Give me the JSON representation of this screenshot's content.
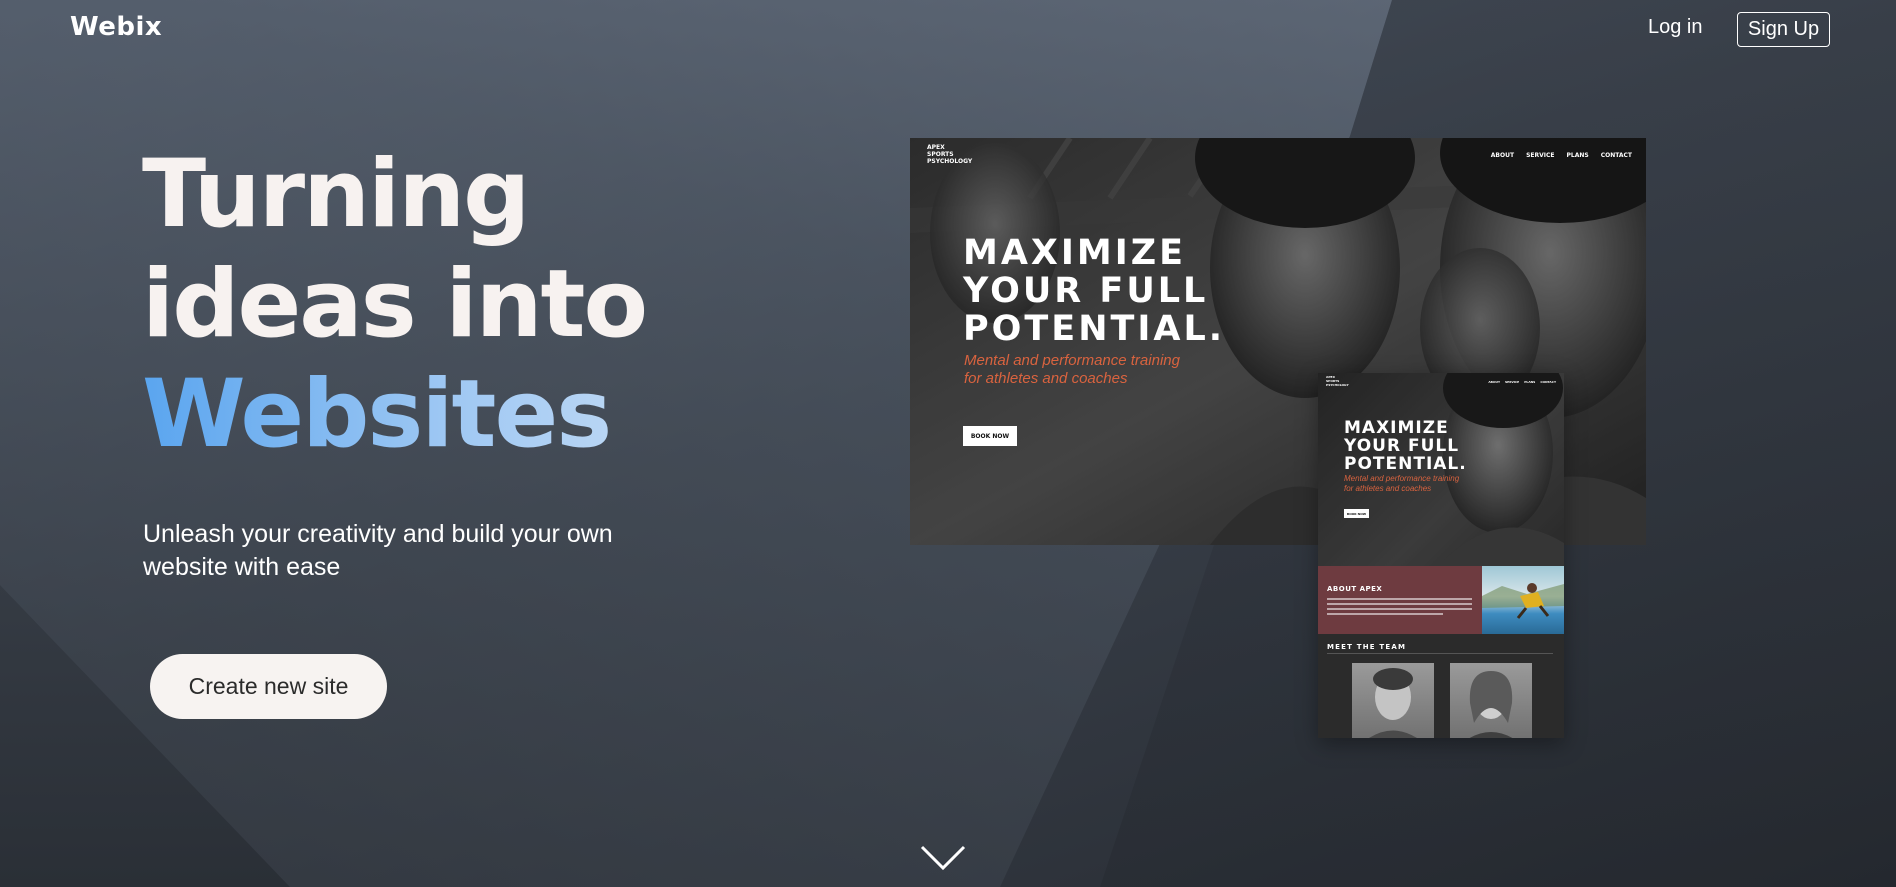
{
  "nav": {
    "logo": "Webix",
    "login_label": "Log in",
    "signup_label": "Sign Up"
  },
  "hero": {
    "title_line1": "Turning",
    "title_line2": "ideas into",
    "title_line3": "Websites",
    "subtitle": "Unleash your creativity and build your own website with ease",
    "cta_label": "Create new site"
  },
  "preview_desktop": {
    "brand": [
      "APEX",
      "SPORTS",
      "PSYCHOLOGY"
    ],
    "nav_items": [
      "ABOUT",
      "SERVICE",
      "PLANS",
      "CONTACT"
    ],
    "headline": [
      "MAXIMIZE",
      "YOUR FULL",
      "POTENTIAL."
    ],
    "tagline": [
      "Mental and performance training",
      "for athletes and coaches"
    ],
    "book_label": "BOOK NOW"
  },
  "preview_mobile": {
    "headline": [
      "MAXIMIZE",
      "YOUR FULL",
      "POTENTIAL."
    ],
    "tagline": [
      "Mental and performance training",
      "for athletes and coaches"
    ],
    "book_label": "BOOK NOW",
    "about_title": "ABOUT APEX",
    "team_title": "MEET THE TEAM"
  },
  "icons": {
    "scroll": "chevron-down-icon"
  },
  "colors": {
    "accent_gradient_start": "#5aa5ef",
    "accent_gradient_end": "#c7ddf5",
    "tagline": "#d9633f",
    "about_bg": "#6e3b40",
    "cta_bg": "#f7f3f1"
  }
}
